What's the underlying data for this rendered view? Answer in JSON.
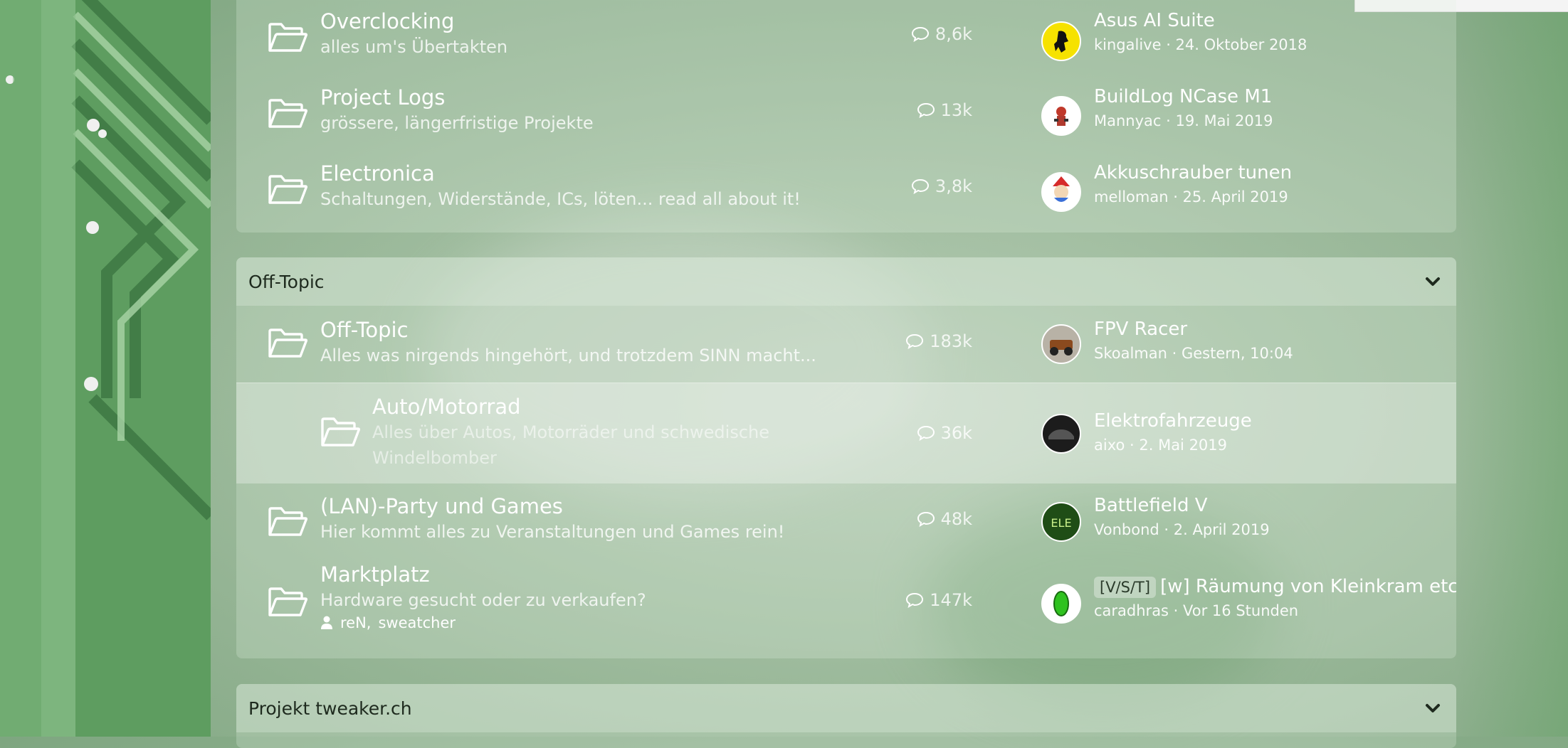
{
  "colors": {
    "accent_bg": "#5c9a5e",
    "text": "#ffffff",
    "header_text": "#1e2a1e"
  },
  "categories": [
    {
      "title": "",
      "forums": [
        {
          "title": "Overclocking",
          "description": "alles um's Übertakten",
          "messages": "8,6k",
          "latest": {
            "title": "Asus AI Suite",
            "meta": "kingalive · 24. Oktober 2018",
            "avatar": "ferrari-avatar"
          }
        },
        {
          "title": "Project Logs",
          "description": "grössere, längerfristige Projekte",
          "messages": "13k",
          "latest": {
            "title": "BuildLog NCase M1",
            "meta": "Mannyac · 19. Mai 2019",
            "avatar": "cartoon-avatar"
          }
        },
        {
          "title": "Electronica",
          "description": "Schaltungen, Widerstände, ICs, löten... read all about it!",
          "messages": "3,8k",
          "latest": {
            "title": "Akkuschrauber tunen",
            "meta": "melloman · 25. April 2019",
            "avatar": "santa-avatar"
          }
        }
      ]
    },
    {
      "title": "Off-Topic",
      "forums": [
        {
          "title": "Off-Topic",
          "description": "Alles was nirgends hingehört, und trotzdem SINN macht...",
          "messages": "183k",
          "latest": {
            "title": "FPV Racer",
            "meta": "Skoalman · Gestern, 10:04",
            "avatar": "car-avatar"
          }
        },
        {
          "title": "Auto/Motorrad",
          "description": "Alles über Autos, Motorräder und schwedische Windelbomber",
          "messages": "36k",
          "latest": {
            "title": "Elektrofahrzeuge",
            "meta": "aixo · 2. Mai 2019",
            "avatar": "dark-car-avatar"
          }
        },
        {
          "title": "(LAN)-Party und Games",
          "description": "Hier kommt alles zu Veranstaltungen und Games rein!",
          "messages": "48k",
          "latest": {
            "title": "Battlefield V",
            "meta": "Vonbond · 2. April 2019",
            "avatar": "ele-avatar"
          }
        },
        {
          "title": "Marktplatz",
          "description": "Hardware gesucht oder zu verkaufen?",
          "messages": "147k",
          "moderators": [
            "reN,",
            "sweatcher"
          ],
          "latest": {
            "prefix": "[V/S/T]",
            "title": "[w] Räumung von Kleinkram etc.",
            "meta": "caradhras · Vor 16 Stunden",
            "avatar": "green-gem-avatar"
          }
        }
      ]
    },
    {
      "title": "Projekt tweaker.ch"
    }
  ]
}
